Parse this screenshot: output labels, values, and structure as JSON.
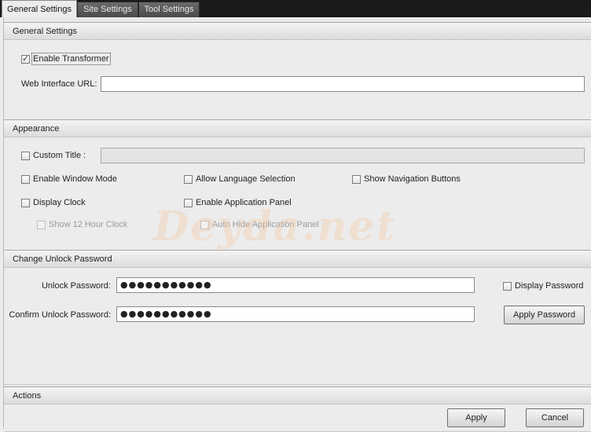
{
  "tabs": [
    {
      "label": "General Settings",
      "active": true
    },
    {
      "label": "Site Settings",
      "active": false
    },
    {
      "label": "Tool Settings",
      "active": false
    }
  ],
  "general": {
    "header": "General Settings",
    "enable_transformer": {
      "label": "Enable Transformer",
      "checked": true
    },
    "web_url": {
      "label": "Web Interface URL:",
      "value": ""
    }
  },
  "appearance": {
    "header": "Appearance",
    "custom_title": {
      "label": "Custom Title :",
      "checked": false,
      "value": ""
    },
    "enable_window_mode": {
      "label": "Enable Window Mode",
      "checked": false
    },
    "allow_language_selection": {
      "label": "Allow Language Selection",
      "checked": false
    },
    "show_navigation_buttons": {
      "label": "Show Navigation Buttons",
      "checked": false
    },
    "display_clock": {
      "label": "Display Clock",
      "checked": false
    },
    "enable_application_panel": {
      "label": "Enable Application Panel",
      "checked": false
    },
    "show_12_hour_clock": {
      "label": "Show 12 Hour Clock",
      "checked": false,
      "disabled": true
    },
    "auto_hide_application_panel": {
      "label": "Auto Hide Application Panel",
      "checked": false,
      "disabled": true
    }
  },
  "password": {
    "header": "Change Unlock Password",
    "unlock_label": "Unlock Password:",
    "unlock_value": "●●●●●●●●●●●",
    "confirm_label": "Confirm Unlock Password:",
    "confirm_value": "●●●●●●●●●●●",
    "display_password": {
      "label": "Display Password",
      "checked": false
    },
    "apply_password_label": "Apply Password"
  },
  "actions": {
    "header": "Actions",
    "apply_label": "Apply",
    "cancel_label": "Cancel"
  },
  "watermark": "Deyda.net"
}
